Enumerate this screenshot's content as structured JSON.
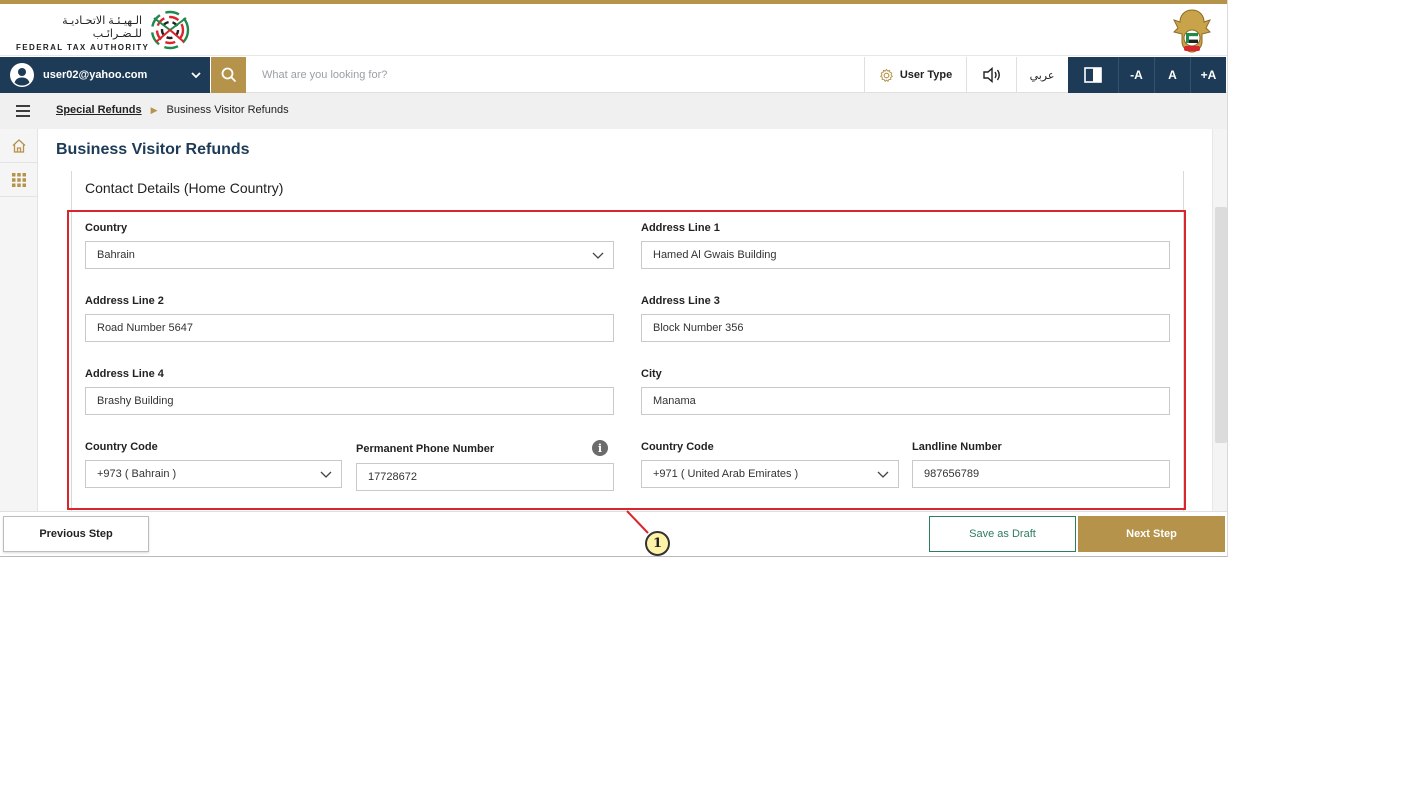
{
  "branding": {
    "name_ar": "الـهيـئـة الاتحـاديـة للـضـرائـب",
    "name_en": "FEDERAL TAX AUTHORITY",
    "logo_icon": "fta-logo-icon",
    "emblem_icon": "uae-emblem-icon"
  },
  "header": {
    "user_email": "user02@yahoo.com",
    "search_placeholder": "What are you looking for?",
    "user_type_label": "User Type",
    "language_label": "عربي",
    "font_decrease_label": "-A",
    "font_normal_label": "A",
    "font_increase_label": "+A"
  },
  "breadcrumb": {
    "parent": "Special Refunds",
    "current": "Business Visitor Refunds"
  },
  "page": {
    "title": "Business Visitor Refunds",
    "section_title": "Contact Details (Home Country)"
  },
  "form": {
    "country": {
      "label": "Country",
      "value": "Bahrain"
    },
    "address_line_1": {
      "label": "Address Line 1",
      "value": "Hamed Al Gwais Building"
    },
    "address_line_2": {
      "label": "Address Line 2",
      "value": "Road Number 5647"
    },
    "address_line_3": {
      "label": "Address Line 3",
      "value": "Block Number 356"
    },
    "address_line_4": {
      "label": "Address Line 4",
      "value": "Brashy Building"
    },
    "city": {
      "label": "City",
      "value": "Manama"
    },
    "phone_country_code": {
      "label": "Country Code",
      "value": "+973 ( Bahrain )"
    },
    "permanent_phone": {
      "label": "Permanent Phone Number",
      "value": "17728672",
      "info_glyph": "i"
    },
    "landline_country_code": {
      "label": "Country Code",
      "value": "+971 ( United Arab Emirates )"
    },
    "landline_number": {
      "label": "Landline Number",
      "value": "987656789"
    }
  },
  "annotation": {
    "callout_number": "1",
    "highlight_color": "#d9262c"
  },
  "footer": {
    "previous_label": "Previous Step",
    "draft_label": "Save as Draft",
    "next_label": "Next Step"
  },
  "colors": {
    "primary_navy": "#1d3b57",
    "accent_gold": "#b5934a",
    "draft_green": "#2e7d5b"
  }
}
